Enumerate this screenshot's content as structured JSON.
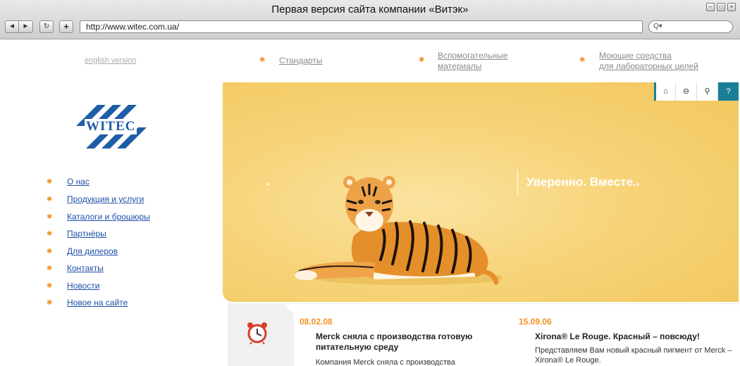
{
  "browser": {
    "title": "Первая версия сайта компании «Витэк»",
    "url": "http://www.witec.com.ua/",
    "search_placeholder": "Q▾",
    "back_icon": "◄",
    "forward_icon": "►",
    "reload_icon": "↻",
    "add_icon": "+"
  },
  "header": {
    "english_link": "english version",
    "nav": [
      {
        "line1": "Стандарты",
        "line2": ""
      },
      {
        "line1": "Вспомогательные",
        "line2": "материалы"
      },
      {
        "line1": "Моющие средства",
        "line2": "для лабораторных целей"
      }
    ]
  },
  "logo": {
    "text": "WITEC"
  },
  "menu": [
    {
      "label": "О нас"
    },
    {
      "label": "Продукция и услуги"
    },
    {
      "label": "Каталоги и брошюры"
    },
    {
      "label": "Партнёры"
    },
    {
      "label": "Для дилеров"
    },
    {
      "label": "Контакты"
    },
    {
      "label": "Новости"
    },
    {
      "label": "Новое на сайте"
    }
  ],
  "banner": {
    "slogan": "Уверенно. Вместе.",
    "tools": [
      "home-icon",
      "mail-icon",
      "search-icon",
      "help-icon"
    ]
  },
  "news": [
    {
      "date": "08.02.08",
      "title": "Merck сняла с производства готовую питательную среду",
      "text": "Компания Merck сняла с производства"
    },
    {
      "date": "15.09.06",
      "title": "Xirona® Le Rouge. Красный – повсюду!",
      "text": "Представляем Вам новый красный пигмент от Merck – Xirona® Le Rouge."
    }
  ],
  "colors": {
    "accent": "#f39222",
    "link": "#1f4fa8",
    "banner": "#f5cd6a",
    "tool_accent": "#1a7f96",
    "logo": "#1f5da8"
  }
}
